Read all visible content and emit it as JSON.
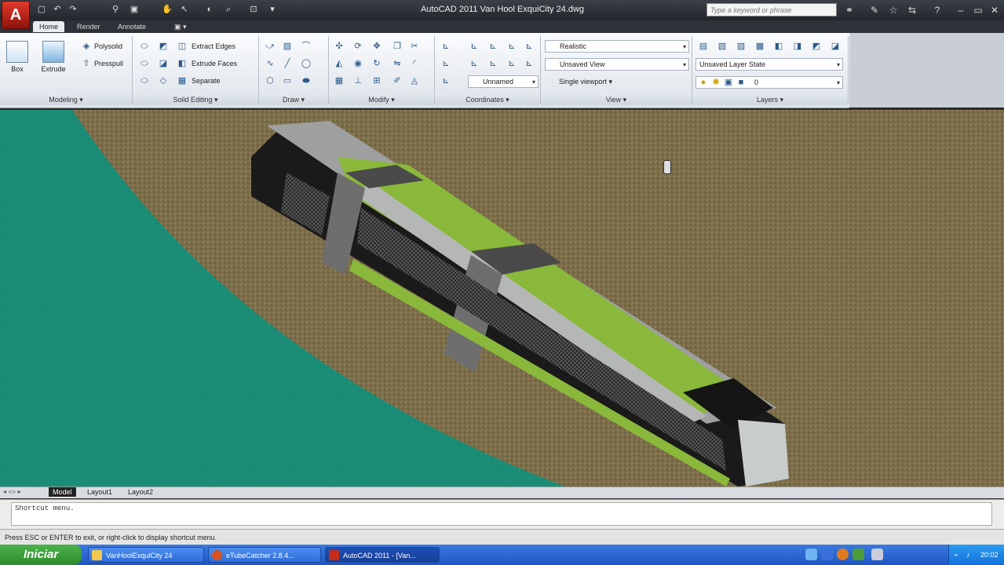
{
  "window": {
    "title": "AutoCAD 2011   Van Hool ExquiCity 24.dwg",
    "search_placeholder": "Type a keyword or phrase",
    "app_letter": "A"
  },
  "tabs": [
    "Home",
    "Render",
    "Annotate",
    "▣ ▾"
  ],
  "ribbon": {
    "modeling": {
      "title": "Modeling",
      "box": "Box",
      "extrude": "Extrude",
      "polysolid": "Polysolid",
      "presspull": "Presspull"
    },
    "solid_editing": {
      "title": "Solid Editing",
      "extract_edges": "Extract Edges",
      "extrude_faces": "Extrude Faces",
      "separate": "Separate"
    },
    "draw": {
      "title": "Draw"
    },
    "modify": {
      "title": "Modify"
    },
    "coordinates": {
      "title": "Coordinates",
      "ucs": "Unnamed"
    },
    "view": {
      "title": "View",
      "visual_style": "Realistic",
      "named_view": "Unsaved View",
      "viewport": "Single viewport"
    },
    "layers": {
      "title": "Layers",
      "layer_state": "Unsaved Layer State",
      "current_layer": "0"
    }
  },
  "layout_tabs": [
    "Model",
    "Layout1",
    "Layout2"
  ],
  "command_line": "Shortcut menu.",
  "status_text": "Press ESC or ENTER to exit, or right-click to display shortcut menu.",
  "taskbar": {
    "start": "Iniciar",
    "items": [
      "VanHoolExquiCity 24",
      "eTubeCatcher 2.8.4...",
      "AutoCAD 2011 - [Van..."
    ],
    "clock": "20:02"
  },
  "colors": {
    "ground": "#7a6c48",
    "water": "#1c8f78",
    "bus_green": "#8ab83a",
    "bus_gray": "#9a9a9a"
  }
}
